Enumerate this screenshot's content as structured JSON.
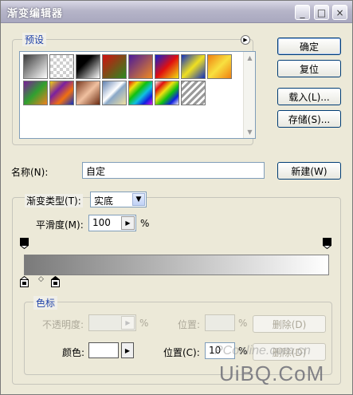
{
  "window": {
    "title": "渐变编辑器"
  },
  "titlebar_buttons": {
    "minimize": "_",
    "maximize": "□",
    "close": "×"
  },
  "presets": {
    "legend": "预设",
    "menu_arrow": "▶",
    "swatches": [
      "foreground-to-background",
      "foreground-to-transparent",
      "black-white",
      "red-green",
      "violet-orange",
      "blue-red-yellow",
      "blue-yellow-blue",
      "orange-yellow-orange",
      "violet-green-orange",
      "yellow-violet-orange-blue",
      "copper",
      "chrome",
      "spectrum",
      "transparent-rainbow",
      "transparent-stripes"
    ]
  },
  "buttons": {
    "ok": "确定",
    "reset": "复位",
    "load": "载入(L)...",
    "save": "存储(S)...",
    "new": "新建(W)",
    "delete_opacity": "删除(D)",
    "delete_color": "删除(D)"
  },
  "name": {
    "label": "名称(N):",
    "value": "自定"
  },
  "gradient_type": {
    "label": "渐变类型(T):",
    "value": "实底"
  },
  "smoothness": {
    "label": "平滑度(M):",
    "value": "100",
    "unit": "%"
  },
  "color_stops": {
    "legend": "色标",
    "opacity_label": "不透明度:",
    "opacity_unit": "%",
    "opacity_location_label": "位置:",
    "opacity_location_unit": "%",
    "color_label": "颜色:",
    "color_location_label": "位置(C):",
    "color_location_value": "10",
    "color_location_unit": "%"
  },
  "watermark": {
    "line1": "PConline.com.cn",
    "line2": "UiBQ.CoM"
  },
  "colors": {
    "title_text": "#ffffff",
    "link_blue": "#2244aa",
    "gradient_start": "#7a7a7a",
    "gradient_end": "#ffffff"
  }
}
